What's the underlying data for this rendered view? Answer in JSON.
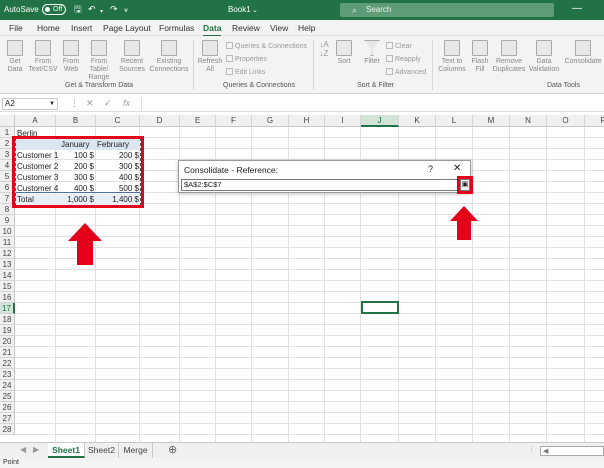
{
  "titlebar": {
    "autosave_label": "AutoSave",
    "autosave_state": "Off",
    "workbook_name": "Book1",
    "search_placeholder": "Search"
  },
  "menu": {
    "items": [
      "File",
      "Home",
      "Insert",
      "Page Layout",
      "Formulas",
      "Data",
      "Review",
      "View",
      "Help"
    ],
    "active": "Data"
  },
  "ribbon": {
    "get_data": "Get\nData",
    "from_text_csv": "From\nText/CSV",
    "from_web": "From\nWeb",
    "from_table_range": "From Table/\nRange",
    "recent_sources": "Recent\nSources",
    "existing_connections": "Existing\nConnections",
    "group_get_transform": "Get & Transform Data",
    "refresh_all": "Refresh\nAll",
    "queries_connections": "Queries & Connections",
    "properties": "Properties",
    "edit_links": "Edit Links",
    "group_queries": "Queries & Connections",
    "sort": "Sort",
    "filter": "Filter",
    "clear": "Clear",
    "reapply": "Reapply",
    "advanced": "Advanced",
    "group_sort_filter": "Sort & Filter",
    "text_to_columns": "Text to\nColumns",
    "flash_fill": "Flash\nFill",
    "remove_duplicates": "Remove\nDuplicates",
    "data_validation": "Data\nValidation",
    "consolidate": "Consolidate",
    "group_data_tools": "Data Tools"
  },
  "formula_bar": {
    "name_box": "A2",
    "fx": "fx",
    "value": ""
  },
  "grid": {
    "columns": [
      "A",
      "B",
      "C",
      "D",
      "E",
      "F",
      "G",
      "H",
      "I",
      "J",
      "K",
      "L",
      "M",
      "N",
      "O",
      "P"
    ],
    "selected_column": "J",
    "rows": [
      "1",
      "2",
      "3",
      "4",
      "5",
      "6",
      "7",
      "8",
      "9",
      "10",
      "11",
      "12",
      "13",
      "14",
      "15",
      "16",
      "17",
      "18",
      "19",
      "20",
      "21",
      "22",
      "23",
      "24",
      "25",
      "26",
      "27",
      "28"
    ],
    "selected_row": "17",
    "a1": "Berlin",
    "header_january": "January",
    "header_february": "February",
    "table": [
      [
        "Customer 1",
        "100 $",
        "200 $"
      ],
      [
        "Customer 2",
        "200 $",
        "300 $"
      ],
      [
        "Customer 3",
        "300 $",
        "400 $"
      ],
      [
        "Customer 4",
        "400 $",
        "500 $"
      ],
      [
        "Total",
        "1,000 $",
        "1,400 $"
      ]
    ]
  },
  "dialog": {
    "title": "Consolidate - Reference:",
    "help": "?",
    "close": "✕",
    "reference_value": "$A$2:$C$7"
  },
  "sheets": {
    "tabs": [
      "Sheet1",
      "Sheet2",
      "Merge"
    ],
    "active": "Sheet1",
    "add": "⊕"
  },
  "status": {
    "mode": "Point"
  },
  "colors": {
    "excel_green": "#217346",
    "highlight_red": "#e4001b",
    "header_fill": "#dce6f1"
  }
}
